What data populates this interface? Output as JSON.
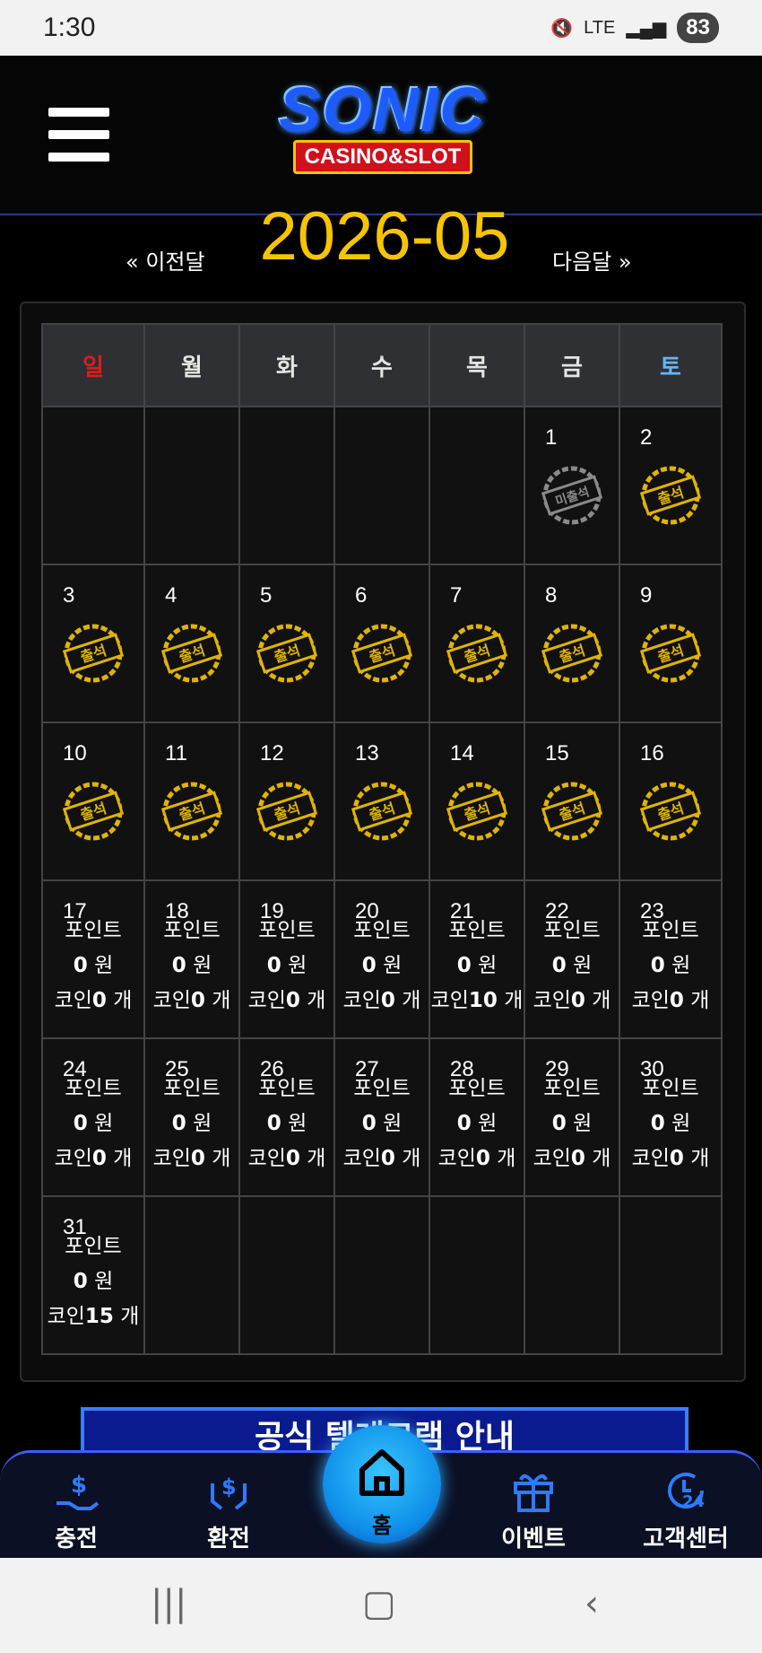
{
  "status": {
    "time": "1:30",
    "network": "LTE",
    "battery": "83"
  },
  "header": {
    "logo_top": "SONIC",
    "logo_bottom": "CASINO&SLOT"
  },
  "month_nav": {
    "prev": "« 이전달",
    "title": "2026-05",
    "next": "다음달 »"
  },
  "calendar": {
    "weekdays": [
      "일",
      "월",
      "화",
      "수",
      "목",
      "금",
      "토"
    ],
    "weeks": [
      [
        {
          "d": ""
        },
        {
          "d": ""
        },
        {
          "d": ""
        },
        {
          "d": ""
        },
        {
          "d": ""
        },
        {
          "d": "1",
          "stamp": "absent"
        },
        {
          "d": "2",
          "stamp": "present"
        }
      ],
      [
        {
          "d": "3",
          "stamp": "present"
        },
        {
          "d": "4",
          "stamp": "present"
        },
        {
          "d": "5",
          "stamp": "present"
        },
        {
          "d": "6",
          "stamp": "present"
        },
        {
          "d": "7",
          "stamp": "present"
        },
        {
          "d": "8",
          "stamp": "present"
        },
        {
          "d": "9",
          "stamp": "present"
        }
      ],
      [
        {
          "d": "10",
          "stamp": "present"
        },
        {
          "d": "11",
          "stamp": "present"
        },
        {
          "d": "12",
          "stamp": "present"
        },
        {
          "d": "13",
          "stamp": "present"
        },
        {
          "d": "14",
          "stamp": "present"
        },
        {
          "d": "15",
          "stamp": "present"
        },
        {
          "d": "16",
          "stamp": "present"
        }
      ],
      [
        {
          "d": "17",
          "point": "0",
          "coin": "0"
        },
        {
          "d": "18",
          "point": "0",
          "coin": "0"
        },
        {
          "d": "19",
          "point": "0",
          "coin": "0"
        },
        {
          "d": "20",
          "point": "0",
          "coin": "0"
        },
        {
          "d": "21",
          "point": "0",
          "coin": "10"
        },
        {
          "d": "22",
          "point": "0",
          "coin": "0"
        },
        {
          "d": "23",
          "point": "0",
          "coin": "0"
        }
      ],
      [
        {
          "d": "24",
          "point": "0",
          "coin": "0"
        },
        {
          "d": "25",
          "point": "0",
          "coin": "0"
        },
        {
          "d": "26",
          "point": "0",
          "coin": "0"
        },
        {
          "d": "27",
          "point": "0",
          "coin": "0"
        },
        {
          "d": "28",
          "point": "0",
          "coin": "0"
        },
        {
          "d": "29",
          "point": "0",
          "coin": "0"
        },
        {
          "d": "30",
          "point": "0",
          "coin": "0"
        }
      ],
      [
        {
          "d": "31",
          "point": "0",
          "coin": "15"
        },
        {
          "d": ""
        },
        {
          "d": ""
        },
        {
          "d": ""
        },
        {
          "d": ""
        },
        {
          "d": ""
        },
        {
          "d": ""
        }
      ]
    ],
    "labels": {
      "point": "포인트",
      "won": "원",
      "coin": "코인",
      "unit": "개",
      "absent": "미출석",
      "present": "출석"
    }
  },
  "banner": {
    "text": "공식 텔레그램 안내"
  },
  "bottom_nav": {
    "items": [
      {
        "label": "충전",
        "icon": "deposit-icon"
      },
      {
        "label": "환전",
        "icon": "exchange-icon"
      },
      {
        "label": "홈",
        "icon": "home-icon"
      },
      {
        "label": "이벤트",
        "icon": "gift-icon"
      },
      {
        "label": "고객센터",
        "icon": "support-24-icon"
      }
    ]
  },
  "colors": {
    "accent": "#f6c400",
    "brand_blue": "#1e5bff",
    "sunday": "#e01a1a",
    "saturday": "#5fb6ff"
  }
}
